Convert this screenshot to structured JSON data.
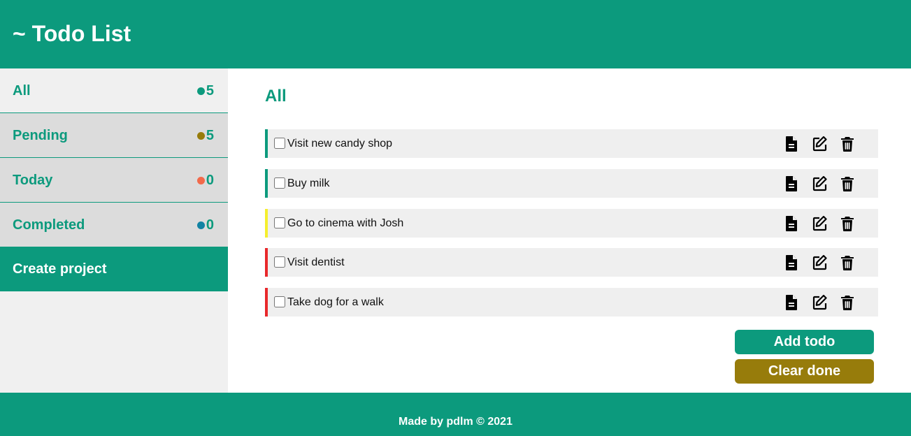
{
  "header": {
    "title": "~ Todo List"
  },
  "sidebar": {
    "items": [
      {
        "label": "All",
        "count": "5",
        "dot_color": "#0c9a7d",
        "active": true
      },
      {
        "label": "Pending",
        "count": "5",
        "dot_color": "#977c0b",
        "active": false
      },
      {
        "label": "Today",
        "count": "0",
        "dot_color": "#f26a4b",
        "active": false
      },
      {
        "label": "Completed",
        "count": "0",
        "dot_color": "#1283a3",
        "active": false
      }
    ],
    "create_project": "Create project"
  },
  "main": {
    "title": "All",
    "todos": [
      {
        "text": "Visit new candy shop",
        "priority_color": "#0c9a7d",
        "checked": false
      },
      {
        "text": "Buy milk",
        "priority_color": "#0c9a7d",
        "checked": false
      },
      {
        "text": "Go to cinema with Josh",
        "priority_color": "#f5ef2e",
        "checked": false
      },
      {
        "text": "Visit dentist",
        "priority_color": "#e8282b",
        "checked": false
      },
      {
        "text": "Take dog for a walk",
        "priority_color": "#e8282b",
        "checked": false
      }
    ],
    "icons": [
      "file-icon",
      "edit-icon",
      "trash-icon"
    ],
    "add_label": "Add todo",
    "clear_label": "Clear done"
  },
  "footer": {
    "text": "Made by pdlm © 2021"
  },
  "colors": {
    "accent": "#0c9a7d",
    "secondary": "#977c0b"
  }
}
